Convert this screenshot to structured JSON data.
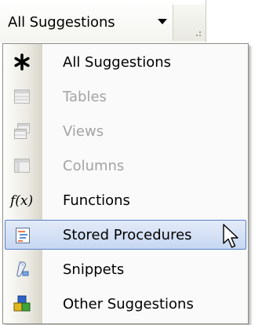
{
  "dropdown": {
    "selected": "All Suggestions"
  },
  "menu": {
    "items": [
      {
        "label": "All Suggestions",
        "icon": "asterisk-icon",
        "enabled": true
      },
      {
        "label": "Tables",
        "icon": "table-icon",
        "enabled": false
      },
      {
        "label": "Views",
        "icon": "views-icon",
        "enabled": false
      },
      {
        "label": "Columns",
        "icon": "columns-icon",
        "enabled": false
      },
      {
        "label": "Functions",
        "icon": "function-icon",
        "enabled": true
      },
      {
        "label": "Stored Procedures",
        "icon": "stored-procedure-icon",
        "enabled": true,
        "selected": true
      },
      {
        "label": "Snippets",
        "icon": "snippet-icon",
        "enabled": true
      },
      {
        "label": "Other Suggestions",
        "icon": "other-suggestions-icon",
        "enabled": true
      }
    ]
  },
  "colors": {
    "selection_border": "#5a80c8",
    "selection_fill": "#c7d7f1",
    "disabled_text": "#a3a3a3"
  }
}
